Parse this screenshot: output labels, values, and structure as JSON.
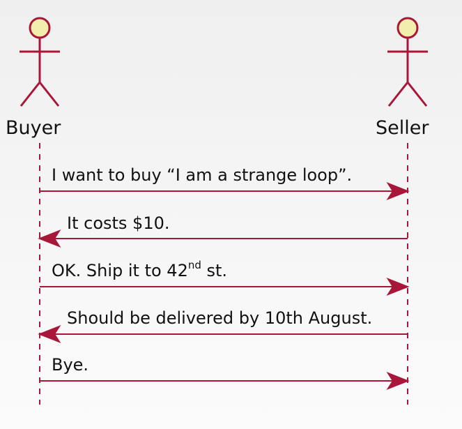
{
  "participants": [
    {
      "id": "buyer",
      "label": "Buyer"
    },
    {
      "id": "seller",
      "label": "Seller"
    }
  ],
  "messages": [
    {
      "from": "buyer",
      "to": "seller",
      "text": "I want to buy “I am a strange loop”.",
      "sup": ""
    },
    {
      "from": "seller",
      "to": "buyer",
      "text": "It costs $10.",
      "sup": ""
    },
    {
      "from": "buyer",
      "to": "seller",
      "text": "OK. Ship it to 42",
      "sup": "nd",
      "suffix": " st."
    },
    {
      "from": "seller",
      "to": "buyer",
      "text": "Should be delivered by 10th August.",
      "sup": ""
    },
    {
      "from": "buyer",
      "to": "seller",
      "text": "Bye.",
      "sup": ""
    }
  ],
  "colors": {
    "line": "#a8173a",
    "actor_head": "#f2efae",
    "text": "#111111"
  }
}
